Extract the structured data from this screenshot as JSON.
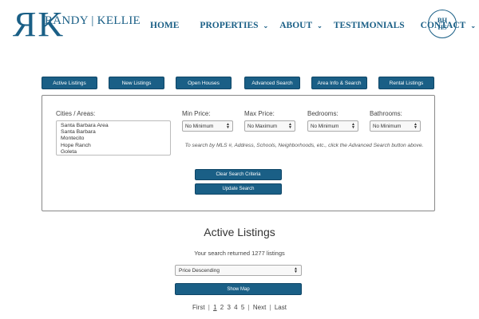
{
  "brand": {
    "monogram": "RK",
    "name": "RANDY | KELLIE",
    "seal_text": [
      "BH",
      "HS"
    ]
  },
  "nav": [
    {
      "label": "HOME",
      "dropdown": false
    },
    {
      "label": "PROPERTIES",
      "dropdown": true
    },
    {
      "label": "ABOUT",
      "dropdown": true
    },
    {
      "label": "TESTIMONIALS",
      "dropdown": false
    },
    {
      "label": "CONTACT",
      "dropdown": true
    }
  ],
  "tabs": [
    "Active Listings",
    "New Listings",
    "Open Houses",
    "Advanced Search",
    "Area Info & Search",
    "Rental Listings"
  ],
  "search": {
    "cities_label": "Cities / Areas:",
    "cities": [
      "Santa Barbara Area",
      "Santa Barbara",
      "Montecito",
      "Hope Ranch",
      "Goleta"
    ],
    "min_price_label": "Min Price:",
    "min_price_value": "No Minimum",
    "max_price_label": "Max Price:",
    "max_price_value": "No Maximum",
    "bedrooms_label": "Bedrooms:",
    "bedrooms_value": "No Minimum",
    "bathrooms_label": "Bathrooms:",
    "bathrooms_value": "No Minimum",
    "hint": "To search by MLS #, Address, Schools, Neighborhoods, etc., click the Advanced Search button above.",
    "clear_label": "Clear Search Criteria",
    "update_label": "Update Search"
  },
  "results": {
    "title": "Active Listings",
    "count_text": "Your search returned 1277 listings",
    "sort_value": "Price Descending",
    "show_map_label": "Show Map"
  },
  "pager": {
    "first": "First",
    "pages": [
      "1",
      "2",
      "3",
      "4",
      "5"
    ],
    "current": "1",
    "next": "Next",
    "last": "Last"
  },
  "colors": {
    "brand_blue": "#1a5f86"
  }
}
